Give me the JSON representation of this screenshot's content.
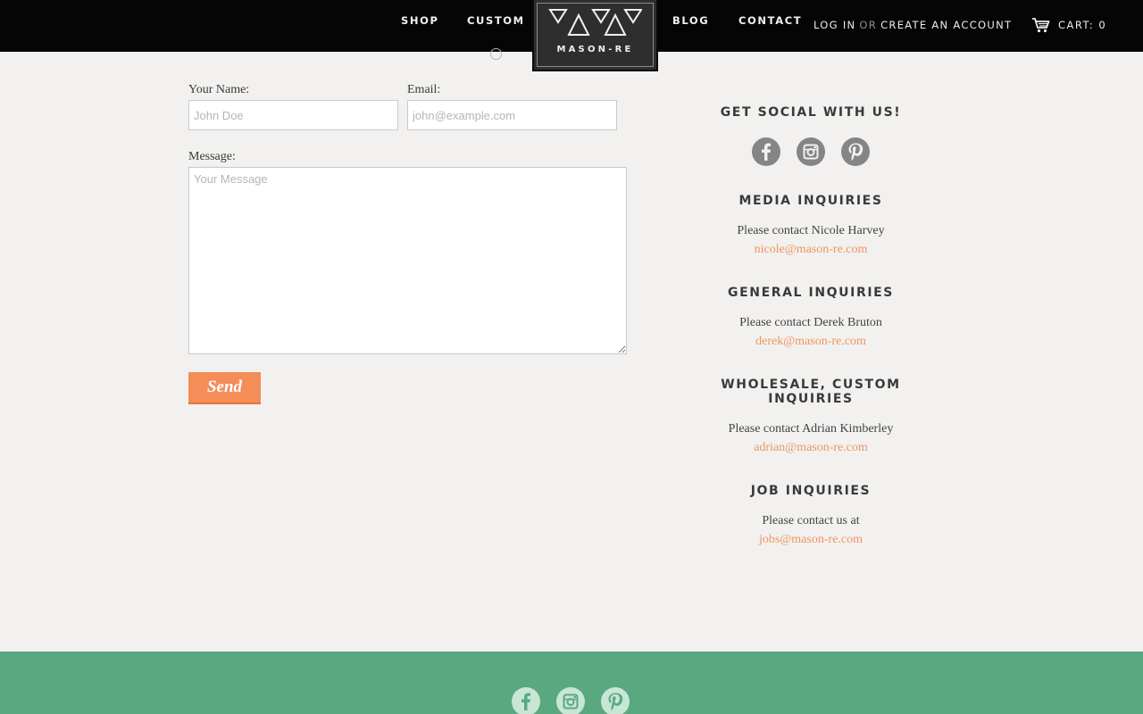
{
  "header": {
    "nav_left": [
      "Shop",
      "Custom"
    ],
    "nav_right": [
      "Blog",
      "Contact"
    ],
    "logo_text": "MASON-RE",
    "login": "Log in",
    "or": "or",
    "create_account": "Create an account",
    "cart": "Cart: 0"
  },
  "form": {
    "name_label": "Your Name:",
    "name_placeholder": "John Doe",
    "email_label": "Email:",
    "email_placeholder": "john@example.com",
    "message_label": "Message:",
    "message_placeholder": "Your Message",
    "send_label": "Send"
  },
  "sidebar": {
    "social_heading": "Get Social With Us!",
    "social_icons": [
      "facebook-icon",
      "instagram-icon",
      "pinterest-icon"
    ],
    "sections": [
      {
        "heading": "Media Inquiries",
        "line": "Please contact Nicole Harvey",
        "email": "nicole@mason-re.com"
      },
      {
        "heading": "General Inquiries",
        "line": "Please contact Derek Bruton",
        "email": "derek@mason-re.com"
      },
      {
        "heading": "Wholesale, Custom Inquiries",
        "line": "Please contact Adrian Kimberley",
        "email": "adrian@mason-re.com"
      },
      {
        "heading": "Job Inquiries",
        "line": "Please contact us at",
        "email": "jobs@mason-re.com"
      }
    ]
  },
  "colors": {
    "header_bg": "#050505",
    "page_bg": "#f2f1ef",
    "accent": "#f48d58",
    "link": "#f0955e",
    "footer_bg": "#5aa880"
  }
}
